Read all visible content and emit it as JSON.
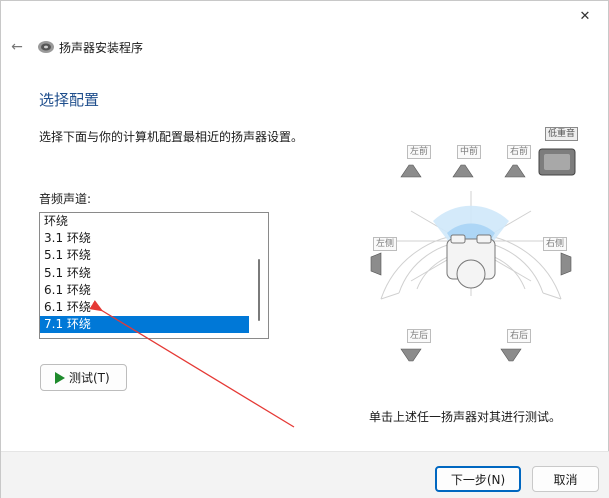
{
  "window": {
    "app_title": "扬声器安装程序",
    "close_glyph": "✕",
    "back_glyph": "←"
  },
  "page": {
    "title": "选择配置",
    "instruction": "选择下面与你的计算机配置最相近的扬声器设置。",
    "channel_label": "音频声道:"
  },
  "channels": {
    "items": [
      "环绕",
      "3.1 环绕",
      "5.1 环绕",
      "5.1 环绕",
      "6.1 环绕",
      "6.1 环绕",
      "7.1 环绕"
    ],
    "selected": "7.1 环绕"
  },
  "test_button": {
    "label": "测试(T)"
  },
  "speakers": {
    "front_left": "左前",
    "center": "中前",
    "front_right": "右前",
    "subwoofer": "低重音",
    "side_left": "左侧",
    "side_right": "右侧",
    "rear_left": "左后",
    "rear_right": "右后"
  },
  "hint": "单击上述任一扬声器对其进行测试。",
  "footer": {
    "next_label": "下一步(N)",
    "cancel_label": "取消"
  },
  "colors": {
    "accent": "#0078d7",
    "title_blue": "#1f4e8c",
    "annotation_red": "#e53935",
    "play_green": "#1e8a2c"
  }
}
